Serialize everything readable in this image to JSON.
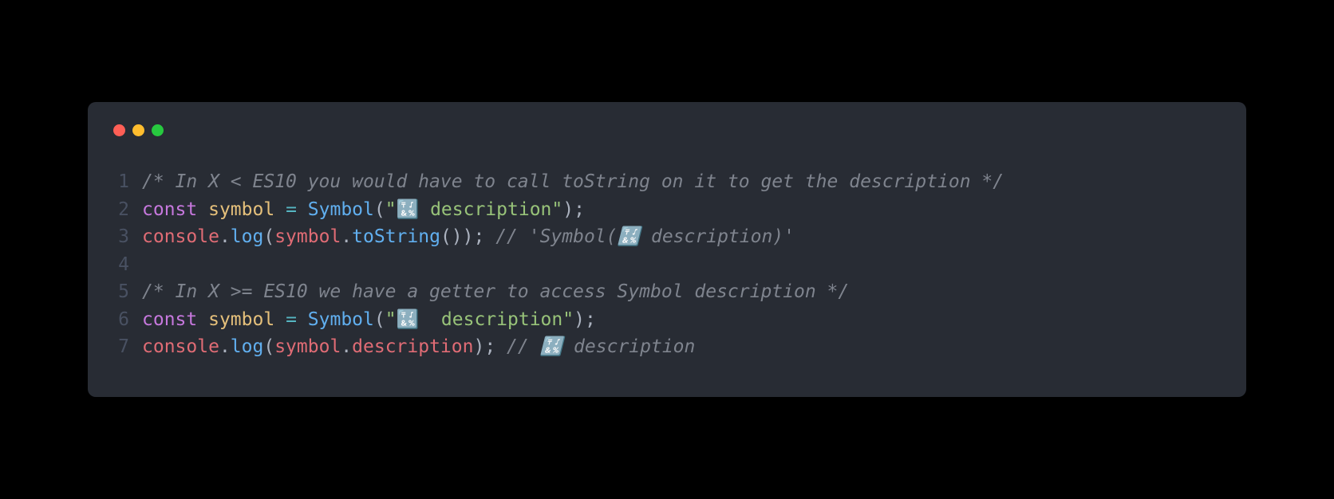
{
  "colors": {
    "bg": "#000000",
    "window_bg": "#282c34",
    "traffic_red": "#ff5f56",
    "traffic_yellow": "#ffbd2e",
    "traffic_green": "#27c93f",
    "ln_muted": "#495162"
  },
  "titlebar": {
    "buttons": [
      "close",
      "minimize",
      "zoom"
    ]
  },
  "code": {
    "language": "javascript",
    "lines": [
      {
        "n": "1",
        "tokens": [
          {
            "cls": "tok-comment",
            "t": "/* In X < ES10 you would have to call toString on it to get the description */"
          }
        ]
      },
      {
        "n": "2",
        "tokens": [
          {
            "cls": "tok-keyword",
            "t": "const"
          },
          {
            "cls": "tok-default",
            "t": " "
          },
          {
            "cls": "tok-variable",
            "t": "symbol"
          },
          {
            "cls": "tok-default",
            "t": " "
          },
          {
            "cls": "tok-operator",
            "t": "="
          },
          {
            "cls": "tok-default",
            "t": " "
          },
          {
            "cls": "tok-function",
            "t": "Symbol"
          },
          {
            "cls": "tok-punc",
            "t": "("
          },
          {
            "cls": "tok-string",
            "t": "\"🔣 description\""
          },
          {
            "cls": "tok-punc",
            "t": ");"
          }
        ]
      },
      {
        "n": "3",
        "tokens": [
          {
            "cls": "tok-ident",
            "t": "console"
          },
          {
            "cls": "tok-punc",
            "t": "."
          },
          {
            "cls": "tok-function",
            "t": "log"
          },
          {
            "cls": "tok-punc",
            "t": "("
          },
          {
            "cls": "tok-ident",
            "t": "symbol"
          },
          {
            "cls": "tok-punc",
            "t": "."
          },
          {
            "cls": "tok-function",
            "t": "toString"
          },
          {
            "cls": "tok-punc",
            "t": "()); "
          },
          {
            "cls": "tok-comment",
            "t": "// 'Symbol(🔣 description)'"
          }
        ]
      },
      {
        "n": "4",
        "tokens": [
          {
            "cls": "tok-default",
            "t": ""
          }
        ]
      },
      {
        "n": "5",
        "tokens": [
          {
            "cls": "tok-comment",
            "t": "/* In X >= ES10 we have a getter to access Symbol description */"
          }
        ]
      },
      {
        "n": "6",
        "tokens": [
          {
            "cls": "tok-keyword",
            "t": "const"
          },
          {
            "cls": "tok-default",
            "t": " "
          },
          {
            "cls": "tok-variable",
            "t": "symbol"
          },
          {
            "cls": "tok-default",
            "t": " "
          },
          {
            "cls": "tok-operator",
            "t": "="
          },
          {
            "cls": "tok-default",
            "t": " "
          },
          {
            "cls": "tok-function",
            "t": "Symbol"
          },
          {
            "cls": "tok-punc",
            "t": "("
          },
          {
            "cls": "tok-string",
            "t": "\"🔣  description\""
          },
          {
            "cls": "tok-punc",
            "t": ");"
          }
        ]
      },
      {
        "n": "7",
        "tokens": [
          {
            "cls": "tok-ident",
            "t": "console"
          },
          {
            "cls": "tok-punc",
            "t": "."
          },
          {
            "cls": "tok-function",
            "t": "log"
          },
          {
            "cls": "tok-punc",
            "t": "("
          },
          {
            "cls": "tok-ident",
            "t": "symbol"
          },
          {
            "cls": "tok-punc",
            "t": "."
          },
          {
            "cls": "tok-ident",
            "t": "description"
          },
          {
            "cls": "tok-punc",
            "t": "); "
          },
          {
            "cls": "tok-comment",
            "t": "// 🔣 description"
          }
        ]
      }
    ]
  }
}
